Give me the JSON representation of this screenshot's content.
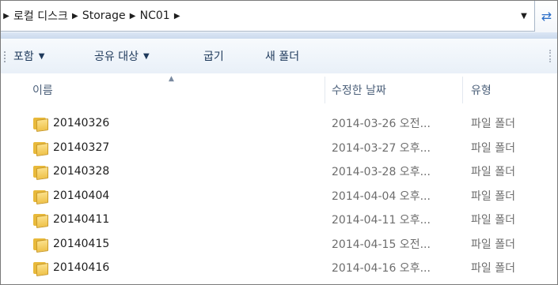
{
  "address": {
    "crumbs": [
      "로컬 디스크",
      "Storage",
      "NC01"
    ],
    "dropdown_icon": "chevron-down-icon",
    "refresh_icon": "refresh-icon"
  },
  "toolbar": {
    "include_label": "포함",
    "share_label": "공유 대상",
    "burn_label": "굽기",
    "new_folder_label": "새 폴더"
  },
  "columns": {
    "name": "이름",
    "modified": "수정한 날짜",
    "type": "유형"
  },
  "files": [
    {
      "name": "20140326",
      "modified": "2014-03-26 오전...",
      "type": "파일 폴더"
    },
    {
      "name": "20140327",
      "modified": "2014-03-27 오후...",
      "type": "파일 폴더"
    },
    {
      "name": "20140328",
      "modified": "2014-03-28 오후...",
      "type": "파일 폴더"
    },
    {
      "name": "20140404",
      "modified": "2014-04-04 오후...",
      "type": "파일 폴더"
    },
    {
      "name": "20140411",
      "modified": "2014-04-11 오후...",
      "type": "파일 폴더"
    },
    {
      "name": "20140415",
      "modified": "2014-04-15 오전...",
      "type": "파일 폴더"
    },
    {
      "name": "20140416",
      "modified": "2014-04-16 오후...",
      "type": "파일 폴더"
    }
  ],
  "colors": {
    "accent": "#2d6fc8",
    "folder": "#efc24a"
  }
}
